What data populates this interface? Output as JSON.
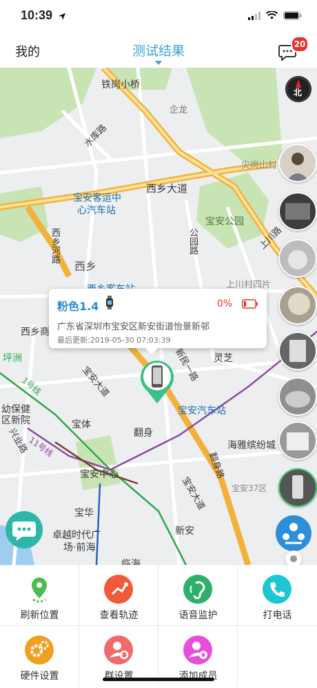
{
  "status": {
    "time": "10:39"
  },
  "nav": {
    "left_label": "我的",
    "title": "测试结果",
    "badge_count": "20"
  },
  "map": {
    "labels": {
      "tiegang": "铁岗小桥",
      "qilong": "企龙",
      "shuiku_road": "水库路",
      "jiangang": "尖岗山村",
      "baoan_terminal_a": "宝安客运中",
      "baoan_terminal_b": "心汽车站",
      "xixiang_avenue": "西乡大道",
      "gongyuan_road": "公园路",
      "baoan_park": "宝安公园",
      "shangchuan_road": "上川路",
      "xihe_road": "西乡河路",
      "xixiang": "西乡",
      "xixiang_station": "西乡客车站",
      "shangchuan_village": "上川村四片",
      "xixiang_shang": "西乡商",
      "pingzhou": "坪洲",
      "lingzhi": "灵芝",
      "line1": "1号线",
      "baoan_avenue": "宝安大道",
      "xinmin_road": "新民一路",
      "baoan_bus_station": "宝安汽车站",
      "youbao": "幼保健",
      "youbao2": "区新院",
      "baoti": "宝体",
      "fanshen": "翻身",
      "xingye_road": "兴业路",
      "line11": "11号线",
      "haiya": "海雅缤纷城",
      "fanshen_road": "翻身路",
      "baoan37": "宝安37区",
      "baoan_center": "宝安中心",
      "baoan_avenue2": "宝安大道",
      "baohua": "宝华",
      "zhuoyue_a": "卓越时代广",
      "zhuoyue_b": "场·前海",
      "xinan": "新安",
      "linhai": "临海"
    }
  },
  "popup": {
    "device_name": "粉色1.4",
    "battery": "0%",
    "address": "广东省深圳市宝安区新安街道怡景新邨",
    "last_update": "最后更新:2019-05-30 07:03:39"
  },
  "compass_label": "北",
  "actions": [
    {
      "label": "刷新位置",
      "icon": "refresh-location-icon",
      "color": "#4dbb4f"
    },
    {
      "label": "查看轨迹",
      "icon": "track-icon",
      "color": "#ef5b3a"
    },
    {
      "label": "语音监护",
      "icon": "voice-monitor-icon",
      "color": "#2eaf6a"
    },
    {
      "label": "打电话",
      "icon": "phone-icon",
      "color": "#1cc7d3"
    },
    {
      "label": "硬件设置",
      "icon": "gear-icon",
      "color": "#f0a020"
    },
    {
      "label": "群设置",
      "icon": "group-settings-icon",
      "color": "#f06a6a"
    },
    {
      "label": "添加成员",
      "icon": "add-member-icon",
      "color": "#e84fd8"
    }
  ]
}
